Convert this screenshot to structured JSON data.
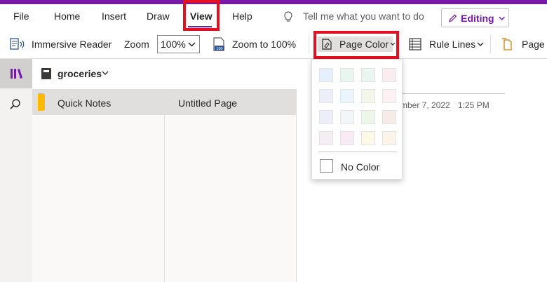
{
  "ribbon": {
    "tabs": [
      "File",
      "Home",
      "Insert",
      "Draw",
      "View",
      "Help"
    ],
    "tell_me": "Tell me what you want to do",
    "editing_label": "Editing"
  },
  "commands": {
    "immersive_reader": "Immersive Reader",
    "zoom_label": "Zoom",
    "zoom_value": "100%",
    "zoom_to_100": "Zoom to 100%",
    "page_color": "Page Color",
    "rule_lines": "Rule Lines",
    "page_version": "Page V"
  },
  "notebook": {
    "name": "groceries",
    "sections": [
      {
        "label": "Quick Notes",
        "color": "#ffb900"
      }
    ],
    "pages": [
      {
        "label": "Untitled Page"
      }
    ]
  },
  "canvas": {
    "date": "mber 7, 2022",
    "time": "1:25 PM"
  },
  "page_color_menu": {
    "swatches": [
      [
        "#e6effc",
        "#e9f6ef",
        "#ecf6f1",
        "#fbecef"
      ],
      [
        "#eeeef8",
        "#eaf6fb",
        "#f2f7ea",
        "#fdf1f4"
      ],
      [
        "#eeeef8",
        "#f4f5f8",
        "#eef6e9",
        "#f7ebea"
      ],
      [
        "#f6eef5",
        "#f8ebf5",
        "#fdf8e8",
        "#fcf3e9"
      ]
    ],
    "no_color": "No Color"
  },
  "colors": {
    "accent": "#7719aa",
    "highlight": "#e5101f"
  }
}
